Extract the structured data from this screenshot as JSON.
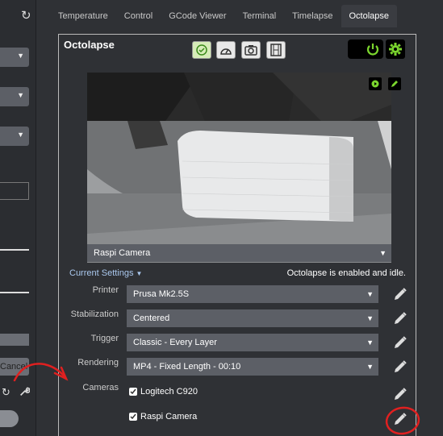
{
  "sidebar": {
    "cancel_label": "Cancel"
  },
  "tabs": [
    "Temperature",
    "Control",
    "GCode Viewer",
    "Terminal",
    "Timelapse",
    "Octolapse"
  ],
  "panel": {
    "title": "Octolapse",
    "camera_label": "Raspi Camera",
    "current_settings_label": "Current Settings",
    "status": "Octolapse is enabled and idle."
  },
  "settings": {
    "printer": {
      "label": "Printer",
      "value": "Prusa Mk2.5S"
    },
    "stabilization": {
      "label": "Stabilization",
      "value": "Centered"
    },
    "trigger": {
      "label": "Trigger",
      "value": "Classic - Every Layer"
    },
    "rendering": {
      "label": "Rendering",
      "value": "MP4 - Fixed Length - 00:10"
    },
    "cameras": {
      "label": "Cameras",
      "items": [
        "Logitech C920",
        "Raspi Camera"
      ]
    }
  },
  "colors": {
    "accent_green": "#7bd62e",
    "annotation_red": "#e02020"
  }
}
